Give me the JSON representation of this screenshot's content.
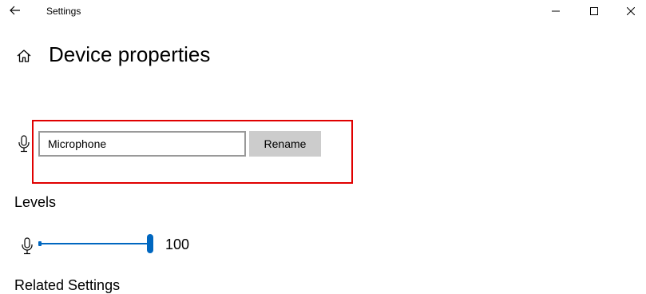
{
  "titlebar": {
    "app_title": "Settings",
    "back_icon": "back-arrow-icon",
    "controls": [
      "minimize-icon",
      "maximize-icon",
      "close-icon"
    ]
  },
  "header": {
    "home_icon": "home-icon",
    "page_title": "Device properties"
  },
  "device_name": {
    "icon": "microphone-icon",
    "input_value": "Microphone",
    "rename_label": "Rename",
    "highlight_color": "#e00000"
  },
  "levels": {
    "heading": "Levels",
    "icon": "microphone-icon",
    "slider_value": 100,
    "slider_max": 100,
    "value_label": "100",
    "accent_color": "#0067c0"
  },
  "related": {
    "heading": "Related Settings"
  }
}
